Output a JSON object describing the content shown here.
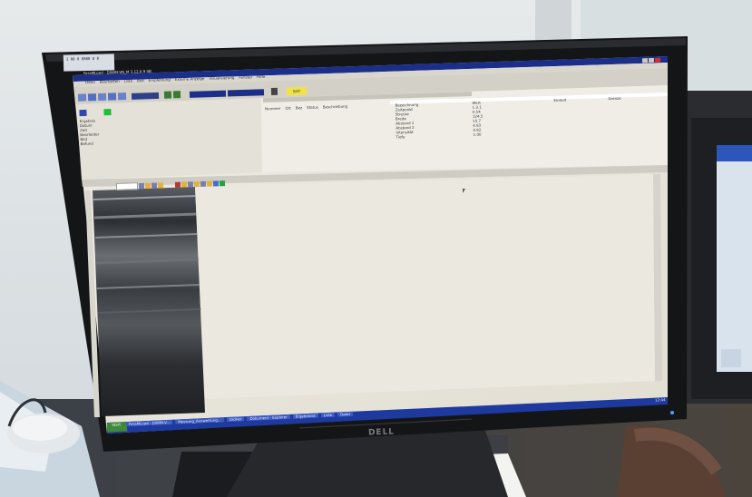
{
  "monitor": {
    "brand": "DELL",
    "sticker": "1 08 0 0888 8 8"
  },
  "app": {
    "title": "FeraMLoad - DIWIN-VN_M 3.12.0.9 SB",
    "menu": [
      "Datei",
      "Bearbeiten",
      "Liste",
      "Bild",
      "Empfehlung",
      "Externe Anzeige",
      "Visualisierung",
      "Fenster",
      "Hilfe"
    ],
    "status_label": "SMT"
  },
  "list_columns": [
    "Nummer",
    "Ort",
    "Bez",
    "Status",
    "Beschreibung"
  ],
  "right_list_columns": [
    "Bezeichnung",
    "Wert",
    "Einheit",
    "Grenze"
  ],
  "right_list_rows": [
    [
      "Zeitpunkt",
      "1.3.1"
    ],
    [
      "Strecke",
      "0.54"
    ],
    [
      "Breite",
      "124.5"
    ],
    [
      "Abstand 1",
      "15.7"
    ],
    [
      "Abstand 2",
      "4.83"
    ],
    [
      "Intensität",
      "0.82"
    ],
    [
      "Tiefe",
      "1.00"
    ]
  ],
  "left_panel_rows": [
    "Ergebnis",
    "Datum",
    "Zeit",
    "Bearbeiter",
    "Bild",
    "Befund"
  ],
  "taskbar": {
    "start_label": "Start",
    "items": [
      "FeraMLoad - DIWIN-V...",
      "Messung_Auswertung...",
      "Ordner",
      "Dokument - Explorer",
      "Ergebnisse",
      "Liste",
      "Datei"
    ],
    "clock": "12:44"
  },
  "colors": {
    "screen_bg": "#e9e5dc",
    "titlebar": "#1b2e8a",
    "bezel": "#151618",
    "accent_yellow": "#f0e24a",
    "scan_dark": "#2a2c30"
  }
}
